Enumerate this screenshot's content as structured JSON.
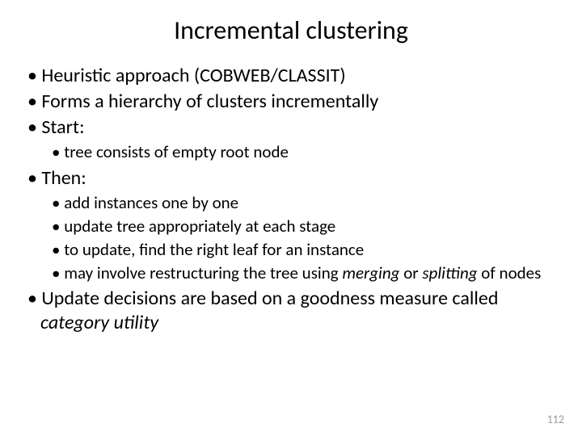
{
  "title": "Incremental clustering",
  "bullets": {
    "b1": "Heuristic approach (COBWEB/CLASSIT)",
    "b2": "Forms a hierarchy of clusters incrementally",
    "b3": "Start:",
    "b3_sub": {
      "s1": "tree consists of empty root node"
    },
    "b4": "Then:",
    "b4_sub": {
      "s1": "add instances one by one",
      "s2": "update tree appropriately at each stage",
      "s3": "to update, find the right leaf for an instance",
      "s4_pre": "may involve restructuring the tree using ",
      "s4_em1": "merging",
      "s4_mid": " or ",
      "s4_em2": "splitting",
      "s4_post": " of nodes"
    },
    "b5_pre": "Update decisions are based on a goodness measure called ",
    "b5_em": "category utility"
  },
  "page_number": "112"
}
